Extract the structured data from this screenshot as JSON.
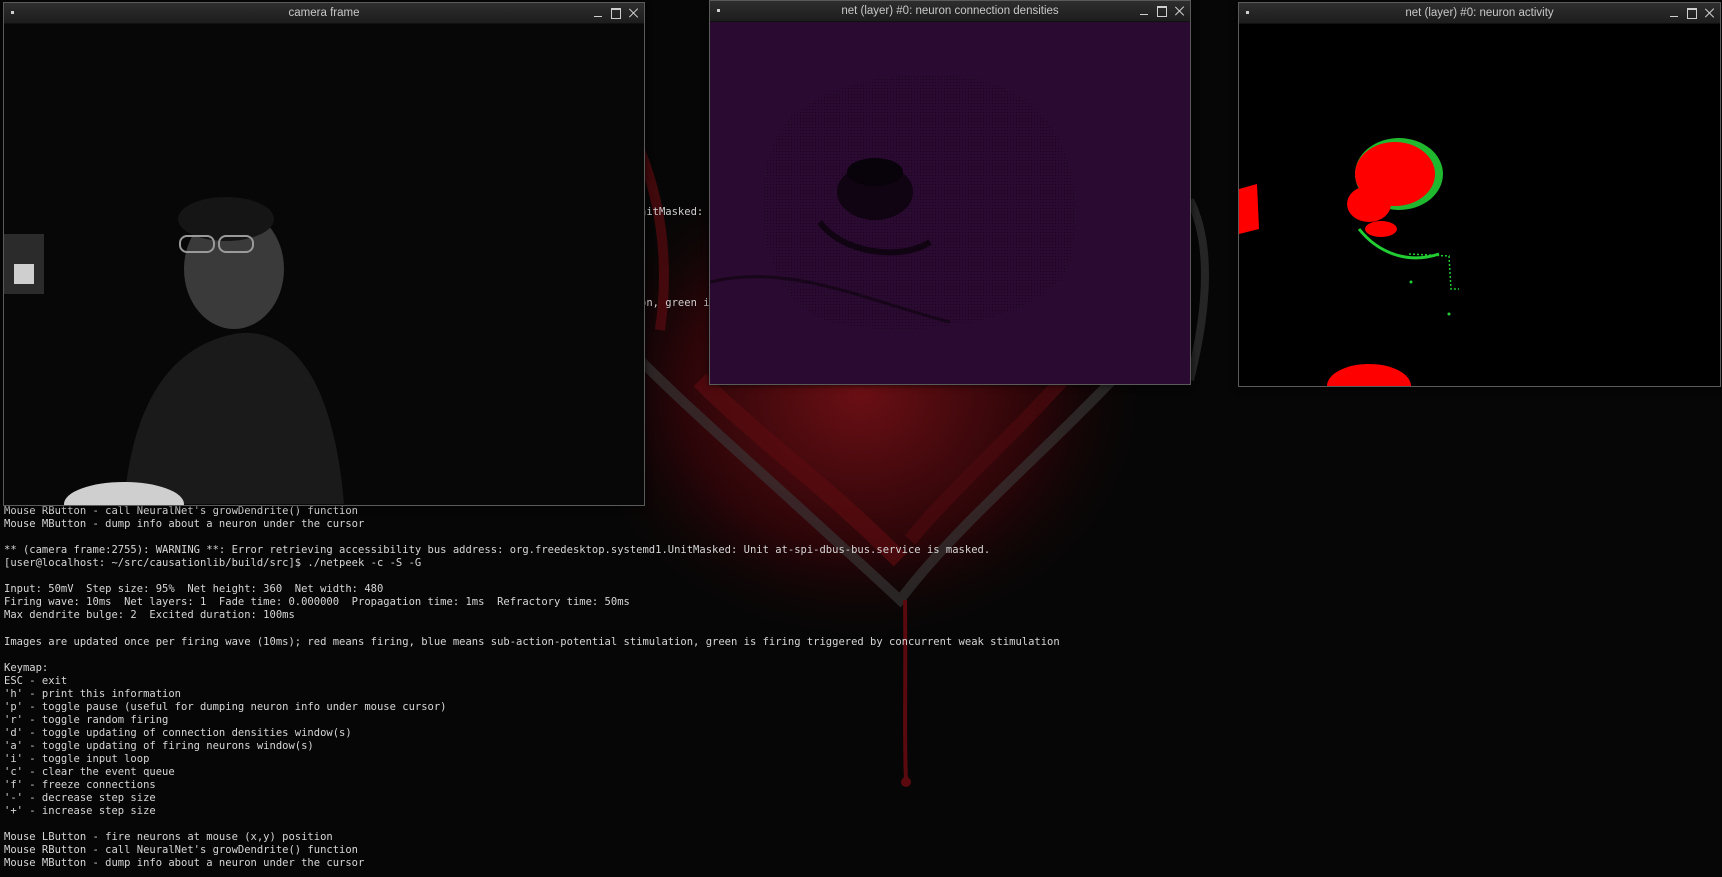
{
  "terminal": {
    "peek_top": "nitMasked: U",
    "peek_mid": "on, green i",
    "lines": [
      "Mouse RButton - call NeuralNet's growDendrite() function",
      "Mouse MButton - dump info about a neuron under the cursor",
      "",
      "** (camera frame:2755): WARNING **: Error retrieving accessibility bus address: org.freedesktop.systemd1.UnitMasked: Unit at-spi-dbus-bus.service is masked.",
      "[user@localhost: ~/src/causationlib/build/src]$ ./netpeek -c -S -G",
      "",
      "Input: 50mV  Step size: 95%  Net height: 360  Net width: 480",
      "Firing wave: 10ms  Net layers: 1  Fade time: 0.000000  Propagation time: 1ms  Refractory time: 50ms",
      "Max dendrite bulge: 2  Excited duration: 100ms",
      "",
      "Images are updated once per firing wave (10ms); red means firing, blue means sub-action-potential stimulation, green is firing triggered by concurrent weak stimulation",
      "",
      "Keymap:",
      "ESC - exit",
      "'h' - print this information",
      "'p' - toggle pause (useful for dumping neuron info under mouse cursor)",
      "'r' - toggle random firing",
      "'d' - toggle updating of connection densities window(s)",
      "'a' - toggle updating of firing neurons window(s)",
      "'i' - toggle input loop",
      "'c' - clear the event queue",
      "'f' - freeze connections",
      "'-' - decrease step size",
      "'+' - increase step size",
      "",
      "Mouse LButton - fire neurons at mouse (x,y) position",
      "Mouse RButton - call NeuralNet's growDendrite() function",
      "Mouse MButton - dump info about a neuron under the cursor"
    ]
  },
  "windows": {
    "camera": {
      "title": "camera frame"
    },
    "densities": {
      "title": "net (layer) #0: neuron connection densities"
    },
    "activity": {
      "title": "net (layer) #0: neuron activity"
    }
  },
  "colors": {
    "density_bg": "#2a0a30",
    "firing": "#ff0000",
    "weak": "#22cc33"
  },
  "icons": [
    "window-menu-icon",
    "minimize-icon",
    "maximize-icon",
    "close-icon"
  ]
}
